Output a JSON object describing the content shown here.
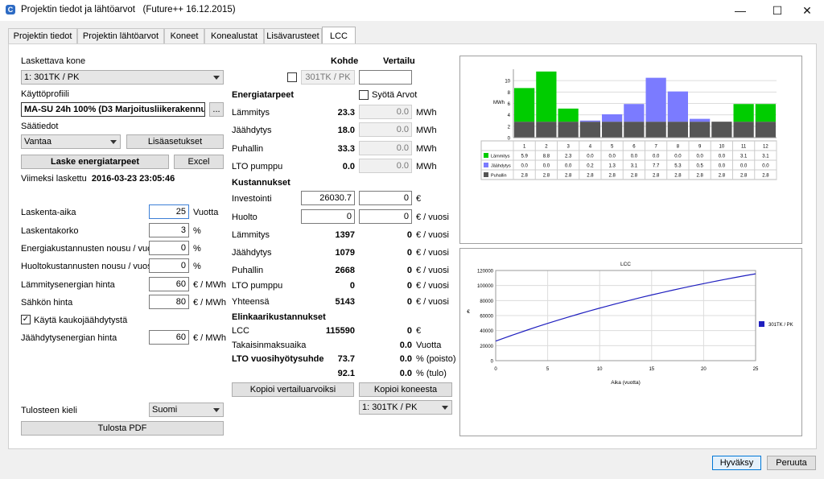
{
  "window": {
    "title": "Projektin tiedot ja lähtöarvot",
    "subtitle": "(Future++ 16.12.2015)",
    "minimize": "—",
    "maximize": "☐",
    "close": "✕"
  },
  "tabs": [
    {
      "label": "Projektin tiedot"
    },
    {
      "label": "Projektin lähtöarvot"
    },
    {
      "label": "Koneet"
    },
    {
      "label": "Konealustat"
    },
    {
      "label": "Lisävarusteet"
    },
    {
      "label": "LCC"
    }
  ],
  "left": {
    "laskettava_kone_label": "Laskettava kone",
    "laskettava_kone_value": "1: 301TK / PK",
    "kayttoprofiili_label": "Käyttöprofiili",
    "kayttoprofiili_value": "MA-SU 24h 100% (D3 Marjoitusliikerakennus)",
    "browse_label": "...",
    "saatiedot_label": "Säätiedot",
    "saatiedot_value": "Vantaa",
    "lisaasetukset_label": "Lisäasetukset",
    "laske_label": "Laske energiatarpeet",
    "excel_label": "Excel",
    "viimeksi_label": "Viimeksi laskettu",
    "viimeksi_value": "2016-03-23 23:05:46",
    "params": [
      {
        "label": "Laskenta-aika",
        "value": "25",
        "unit": "Vuotta"
      },
      {
        "label": "Laskentakorko",
        "value": "3",
        "unit": "%"
      },
      {
        "label": "Energiakustannusten nousu / vuosi",
        "value": "0",
        "unit": "%"
      },
      {
        "label": "Huoltokustannusten nousu / vuosi",
        "value": "0",
        "unit": "%"
      },
      {
        "label": "Lämmitysenergian hinta",
        "value": "60",
        "unit": "€ / MWh"
      },
      {
        "label": "Sähkön hinta",
        "value": "80",
        "unit": "€ / MWh"
      }
    ],
    "kauko_label": "Käytä kaukojäähdytystä",
    "kauko_checked": "✓",
    "jaahdytysenergia_label": "Jäähdytysenergian hinta",
    "jaahdytysenergia_value": "60",
    "jaahdytysenergia_unit": "€ / MWh",
    "tulosteen_kieli_label": "Tulosteen kieli",
    "tulosteen_kieli_value": "Suomi",
    "tulosta_label": "Tulosta PDF"
  },
  "middle": {
    "kohde_label": "Kohde",
    "vertailu_label": "Vertailu",
    "kohde_name": "301TK / PK",
    "vertailu_name": "",
    "energiatarpeet_label": "Energiatarpeet",
    "syota_label": "Syötä Arvot",
    "energy": [
      {
        "label": "Lämmitys",
        "kohde": "23.3",
        "vertailu": "0.0",
        "unit": "MWh"
      },
      {
        "label": "Jäähdytys",
        "kohde": "18.0",
        "vertailu": "0.0",
        "unit": "MWh"
      },
      {
        "label": "Puhallin",
        "kohde": "33.3",
        "vertailu": "0.0",
        "unit": "MWh"
      },
      {
        "label": "LTO pumppu",
        "kohde": "0.0",
        "vertailu": "0.0",
        "unit": "MWh"
      }
    ],
    "kustannukset_label": "Kustannukset",
    "investointi_label": "Investointi",
    "investointi_kohde": "26030.7",
    "investointi_vertailu": "0",
    "investointi_unit": "€",
    "huolto_label": "Huolto",
    "huolto_kohde": "0",
    "huolto_vertailu": "0",
    "huolto_unit": "€ / vuosi",
    "costs": [
      {
        "label": "Lämmitys",
        "kohde": "1397",
        "vertailu": "0",
        "unit": "€ / vuosi"
      },
      {
        "label": "Jäähdytys",
        "kohde": "1079",
        "vertailu": "0",
        "unit": "€ / vuosi"
      },
      {
        "label": "Puhallin",
        "kohde": "2668",
        "vertailu": "0",
        "unit": "€ / vuosi"
      },
      {
        "label": "LTO pumppu",
        "kohde": "0",
        "vertailu": "0",
        "unit": "€ / vuosi"
      },
      {
        "label": "Yhteensä",
        "kohde": "5143",
        "vertailu": "0",
        "unit": "€ / vuosi"
      }
    ],
    "elinkaari_label": "Elinkaarikustannukset",
    "lcc_label": "LCC",
    "lcc_kohde": "115590",
    "lcc_vertailu": "0",
    "lcc_unit": "€",
    "takaisin_label": "Takaisinmaksuaika",
    "takaisin_vertailu": "0.0",
    "takaisin_unit": "Vuotta",
    "lto_label": "LTO vuosihyötysuhde",
    "lto_kohde_1": "73.7",
    "lto_vertailu_1": "0.0",
    "lto_unit_1": "% (poisto)",
    "lto_kohde_2": "92.1",
    "lto_vertailu_2": "0.0",
    "lto_unit_2": "% (tulo)",
    "kopioi_vertailu_label": "Kopioi vertailuarvoiksi",
    "kopioi_koneesta_label": "Kopioi koneesta",
    "kopioi_kone_value": "1: 301TK / PK"
  },
  "footer": {
    "ok_label": "Hyväksy",
    "cancel_label": "Peruuta"
  },
  "colors": {
    "heating": "#00cc00",
    "cooling": "#7b7bff",
    "fan": "#555555",
    "lcc_line": "#1f1fbf"
  },
  "chart_data": [
    {
      "type": "bar",
      "stacked": true,
      "ylabel": "MWh",
      "ylim": [
        0,
        12
      ],
      "yticks": [
        0,
        2,
        4,
        6,
        8,
        10
      ],
      "categories": [
        "1",
        "2",
        "3",
        "4",
        "5",
        "6",
        "7",
        "8",
        "9",
        "10",
        "11",
        "12"
      ],
      "series": [
        {
          "name": "Lämmitys",
          "values": [
            5.9,
            8.8,
            2.3,
            0.0,
            0.0,
            0.0,
            0.0,
            0.0,
            0.0,
            0.0,
            3.1,
            3.1
          ],
          "labels": [
            "5.9",
            "8.8",
            "2.3",
            "0.0",
            "0.0",
            "0.0",
            "0.0",
            "0.0",
            "0.0",
            "0.0",
            "3.1",
            "3.1"
          ]
        },
        {
          "name": "Jäähdytys",
          "values": [
            0.0,
            0.0,
            0.0,
            0.2,
            1.3,
            3.1,
            7.7,
            5.3,
            0.5,
            0.0,
            0.0,
            0.0
          ],
          "labels": [
            "0.0",
            "0.0",
            "0.0",
            "0.2",
            "1.3",
            "3.1",
            "7.7",
            "5.3",
            "0.5",
            "0.0",
            "0.0",
            "0.0"
          ]
        },
        {
          "name": "Puhallin",
          "values": [
            2.8,
            2.8,
            2.8,
            2.8,
            2.8,
            2.8,
            2.8,
            2.8,
            2.8,
            2.8,
            2.8,
            2.8
          ],
          "labels": [
            "2.8",
            "2.8",
            "2.8",
            "2.8",
            "2.8",
            "2.8",
            "2.8",
            "2.8",
            "2.8",
            "2.8",
            "2.8",
            "2.8"
          ]
        }
      ],
      "grid": true
    },
    {
      "type": "line",
      "title": "LCC",
      "xlabel": "Aika (vuotta)",
      "ylabel": "€",
      "xlim": [
        0,
        25
      ],
      "ylim": [
        0,
        120000
      ],
      "xticks": [
        0,
        5,
        10,
        15,
        20,
        25
      ],
      "yticks": [
        0,
        20000,
        40000,
        60000,
        80000,
        100000,
        120000
      ],
      "series": [
        {
          "name": "301TK / PK",
          "x": [
            0,
            1,
            2,
            3,
            4,
            5,
            6,
            7,
            8,
            9,
            10,
            11,
            12,
            13,
            14,
            15,
            16,
            17,
            18,
            19,
            20,
            21,
            22,
            23,
            24,
            25
          ],
          "y": [
            26031,
            31024,
            35872,
            40579,
            45148,
            49585,
            53893,
            58075,
            62136,
            66078,
            69906,
            73622,
            77230,
            80733,
            84134,
            87436,
            90642,
            93754,
            96776,
            99710,
            102558,
            105323,
            108008,
            110614,
            113145,
            115590
          ]
        }
      ],
      "legend": "right",
      "grid": true
    }
  ]
}
